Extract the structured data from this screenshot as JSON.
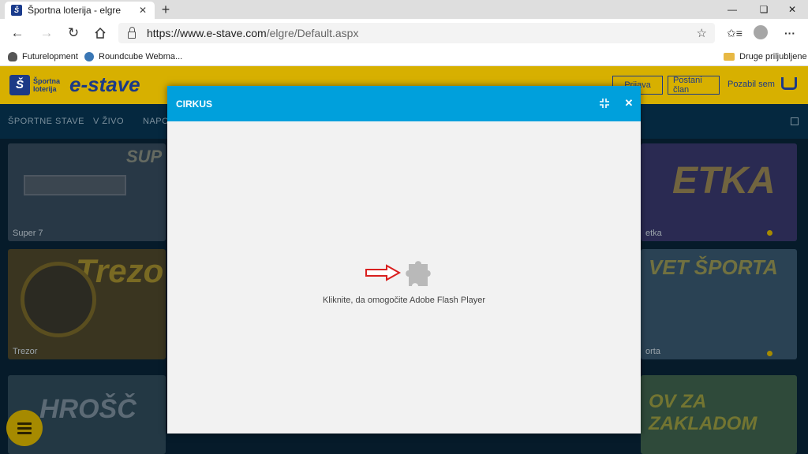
{
  "browser": {
    "tab_title": "Športna loterija - elgre",
    "tab_favicon_letter": "Š",
    "url_host": "https://www.e-stave.com",
    "url_path": "/elgre/Default.aspx",
    "icons": [
      "back-icon",
      "forward-icon",
      "refresh-icon",
      "home-icon",
      "lock-icon",
      "favorite-star-icon",
      "favorites-list-icon",
      "profile-icon",
      "more-icon"
    ],
    "bookmarks": [
      {
        "label": "Futurelopment",
        "icon": "apple-icon"
      },
      {
        "label": "Roundcube Webma...",
        "icon": "roundcube-icon"
      }
    ],
    "other_bookmarks": "Druge priljubljene"
  },
  "site": {
    "brand_small": "Športna loterija",
    "brand_big": "e-stave",
    "header_buttons": [
      "Prijava",
      "Postani član"
    ],
    "header_link": "Pozabil sem",
    "nav_items": [
      "ŠPORTNE STAVE",
      "V ŽIVO",
      "NAPO"
    ],
    "games": [
      {
        "label": "Super 7",
        "art": "SUP"
      },
      {
        "label": "etka",
        "art": "ETKA"
      },
      {
        "label": "Trezor",
        "art": "Trezo"
      },
      {
        "label": "orta",
        "art": "VET ŠPORTA"
      },
      {
        "label": "",
        "art": "HROŠČ"
      },
      {
        "label": "",
        "art": "OV ZA ZAKLADOM"
      }
    ]
  },
  "modal": {
    "title": "CIRKUS",
    "plugin_message": "Kliknite, da omogočite Adobe Flash Player",
    "arrow_color": "#d9201f",
    "header_color": "#00a0dc"
  }
}
